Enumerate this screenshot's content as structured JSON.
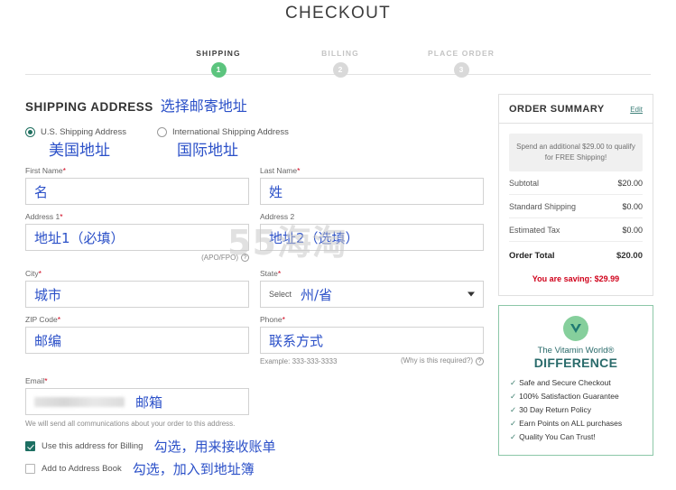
{
  "page": {
    "title": "CHECKOUT",
    "watermark": "55海淘"
  },
  "progress": {
    "steps": [
      {
        "label": "SHIPPING",
        "number": "1",
        "state": "active"
      },
      {
        "label": "BILLING",
        "number": "2",
        "state": "idle"
      },
      {
        "label": "PLACE ORDER",
        "number": "3",
        "state": "idle"
      }
    ],
    "active_color": "#5cc47e",
    "idle_color": "#d9d9d9"
  },
  "shipping": {
    "heading_en": "SHIPPING ADDRESS",
    "heading_cn": "选择邮寄地址",
    "address_type": {
      "us": {
        "label": "U.S. Shipping Address",
        "selected": true,
        "cn": "美国地址"
      },
      "intl": {
        "label": "International Shipping Address",
        "selected": false,
        "cn": "国际地址"
      }
    },
    "fields": {
      "first_name": {
        "label": "First Name",
        "required": true,
        "value": "名"
      },
      "last_name": {
        "label": "Last Name",
        "required": true,
        "value": "姓"
      },
      "address1": {
        "label": "Address 1",
        "required": true,
        "value": "地址1（必填）",
        "hint": "(APO/FPO)"
      },
      "address2": {
        "label": "Address 2",
        "required": false,
        "value": "地址2（选填）"
      },
      "city": {
        "label": "City",
        "required": true,
        "value": "城市"
      },
      "state": {
        "label": "State",
        "required": true,
        "placeholder": "Select",
        "value": "州/省"
      },
      "zip": {
        "label": "ZIP Code",
        "required": true,
        "value": "邮编"
      },
      "phone": {
        "label": "Phone",
        "required": true,
        "value": "联系方式",
        "example": "Example: 333-333-3333",
        "why": "(Why is this required?)"
      },
      "email": {
        "label": "Email",
        "required": true,
        "value": "邮箱",
        "note": "We will send all communications about your order to this address."
      }
    },
    "checkboxes": [
      {
        "label": "Use this address for Billing",
        "checked": true,
        "cn": "勾选，用来接收账单"
      },
      {
        "label": "Add to Address Book",
        "checked": false,
        "cn": "勾选，加入到地址簿"
      }
    ],
    "checkbox_color": "#1d6f62"
  },
  "order_summary": {
    "title": "ORDER SUMMARY",
    "edit_label": "Edit",
    "free_shipping_banner": "Spend an additional $29.00 to qualify for FREE Shipping!",
    "rows": [
      {
        "label": "Subtotal",
        "value": "$20.00"
      },
      {
        "label": "Standard Shipping",
        "value": "$0.00"
      },
      {
        "label": "Estimated Tax",
        "value": "$0.00"
      }
    ],
    "total": {
      "label": "Order Total",
      "value": "$20.00"
    },
    "saving": "You are saving: $29.99",
    "saving_color": "#d0021b"
  },
  "difference": {
    "brand_line": "The Vitamin World®",
    "headline": "DIFFERENCE",
    "items": [
      "Safe and Secure Checkout",
      "100% Satisfaction Guarantee",
      "30 Day Return Policy",
      "Earn Points on ALL purchases",
      "Quality You Can Trust!"
    ],
    "accent_color": "#2a6b6b",
    "logo_bg": "#86cf9c"
  }
}
